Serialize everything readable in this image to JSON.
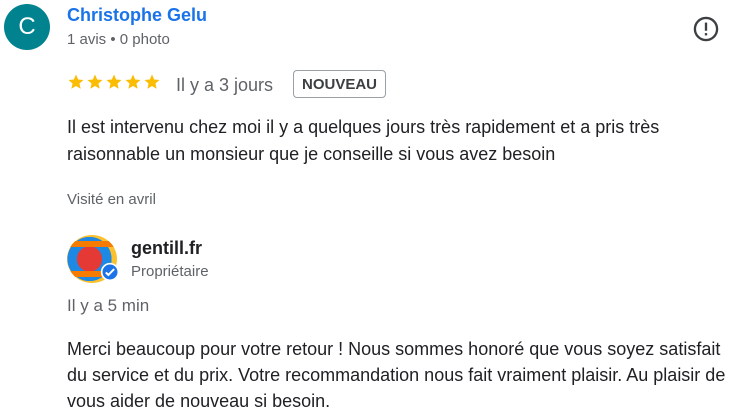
{
  "review": {
    "avatar_letter": "C",
    "author": "Christophe Gelu",
    "author_meta": "1 avis • 0 photo",
    "rating": 5,
    "date": "Il y a 3 jours",
    "badge": "NOUVEAU",
    "text": "Il est intervenu chez moi il y a quelques jours très rapidement et a pris très raisonnable un monsieur que je conseille si vous avez besoin",
    "visited": "Visité en avril"
  },
  "reply": {
    "owner_name": "gentill.fr",
    "owner_role": "Propriétaire",
    "date": "Il y a 5 min",
    "text": "Merci beaucoup pour votre retour ! Nous sommes honoré que vous soyez satisfait du service et du prix. Votre recommandation nous fait vraiment plaisir. Au plaisir de vous aider de nouveau si besoin."
  },
  "colors": {
    "author_link": "#1a73e8",
    "star": "#fbbc04",
    "avatar_bg": "#00838f",
    "verified": "#1a73e8"
  },
  "icons": {
    "report": "report-icon",
    "star": "star-icon",
    "verified": "verified-check-icon"
  }
}
